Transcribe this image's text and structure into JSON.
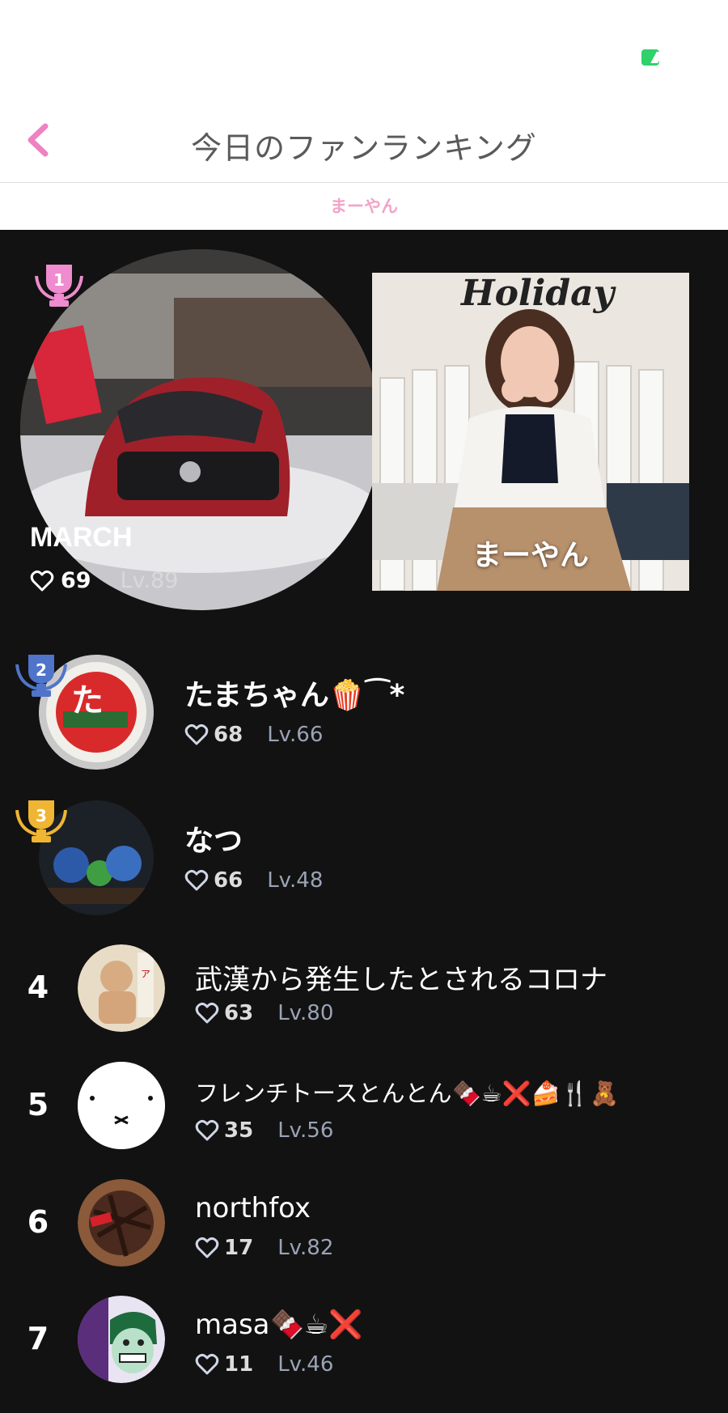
{
  "header": {
    "title": "今日のファンランキング",
    "subtab": "まーやん"
  },
  "top": {
    "rank": "1",
    "name": "MARCH",
    "likes": "69",
    "level": "Lv.89",
    "photo_name": "まーやん",
    "photo_caption": "Holiday"
  },
  "ranking": [
    {
      "rank": "2",
      "name": "たまちゃん🍿⁀*",
      "likes": "68",
      "level": "Lv.66"
    },
    {
      "rank": "3",
      "name": "なつ",
      "likes": "66",
      "level": "Lv.48"
    },
    {
      "rank": "4",
      "name": "武漢から発生したとされるコロナ",
      "likes": "63",
      "level": "Lv.80"
    },
    {
      "rank": "5",
      "name": "フレンチトースとんとん🍫☕❌🍰🍴🧸",
      "likes": "35",
      "level": "Lv.56"
    },
    {
      "rank": "6",
      "name": "northfox",
      "likes": "17",
      "level": "Lv.82"
    },
    {
      "rank": "7",
      "name": "masa🍫☕❌",
      "likes": "11",
      "level": "Lv.46"
    }
  ],
  "colors": {
    "accent_pink": "#f2a4c8",
    "back_pink": "#ee82c2",
    "gold": "#f0b533",
    "silver_blue": "#4f74c9",
    "battery_green": "#2ed16a"
  }
}
